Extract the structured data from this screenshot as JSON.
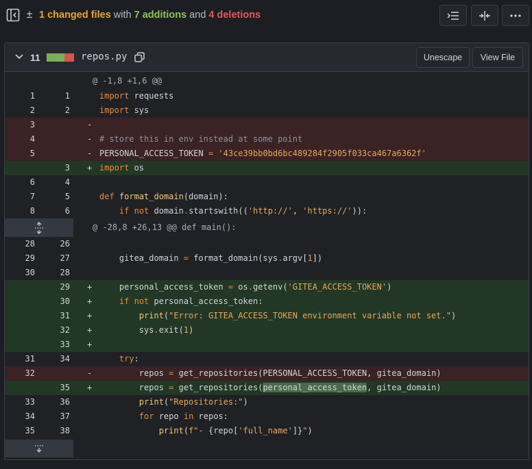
{
  "summary": {
    "changed": "1 changed files",
    "with": " with ",
    "additions": "7 additions",
    "and": " and ",
    "deletions": "4 deletions"
  },
  "file": {
    "count": "11",
    "name": "repos.py",
    "unescape_label": "Unescape",
    "view_file_label": "View File"
  },
  "hunks": {
    "h1": "@ -1,8 +1,6 @@",
    "h2": "@ -28,8 +26,13 @@ def main():"
  },
  "lines": {
    "l1": {
      "o": "1",
      "n": "1",
      "s": ""
    },
    "l2": {
      "o": "2",
      "n": "2",
      "s": ""
    },
    "l3": {
      "o": "3",
      "n": "",
      "s": "-"
    },
    "l4": {
      "o": "4",
      "n": "",
      "s": "-",
      "t": "# store this in env instead at some point"
    },
    "l5": {
      "o": "5",
      "n": "",
      "s": "-",
      "t1": "PERSONAL_ACCESS_TOKEN",
      "t2": "'43ce39bb0bd6bc489284f2905f033ca467a6362f'"
    },
    "l6": {
      "o": "",
      "n": "3",
      "s": "+"
    },
    "l7": {
      "o": "6",
      "n": "4",
      "s": ""
    },
    "l8": {
      "o": "7",
      "n": "5",
      "s": ""
    },
    "l9": {
      "o": "8",
      "n": "6",
      "s": ""
    },
    "l10": {
      "o": "28",
      "n": "26",
      "s": ""
    },
    "l11": {
      "o": "29",
      "n": "27",
      "s": ""
    },
    "l12": {
      "o": "30",
      "n": "28",
      "s": ""
    },
    "l13": {
      "o": "",
      "n": "29",
      "s": "+"
    },
    "l14": {
      "o": "",
      "n": "30",
      "s": "+"
    },
    "l15": {
      "o": "",
      "n": "31",
      "s": "+"
    },
    "l16": {
      "o": "",
      "n": "32",
      "s": "+"
    },
    "l17": {
      "o": "",
      "n": "33",
      "s": "+"
    },
    "l18": {
      "o": "31",
      "n": "34",
      "s": ""
    },
    "l19": {
      "o": "32",
      "n": "",
      "s": "-"
    },
    "l20": {
      "o": "",
      "n": "35",
      "s": "+"
    },
    "l21": {
      "o": "33",
      "n": "36",
      "s": ""
    },
    "l22": {
      "o": "34",
      "n": "37",
      "s": ""
    },
    "l23": {
      "o": "35",
      "n": "38",
      "s": ""
    }
  },
  "colors": {
    "added_bg": "#223725",
    "deleted_bg": "#3b2224",
    "added_bar": "#78b05e",
    "deleted_bar": "#d9534f"
  }
}
